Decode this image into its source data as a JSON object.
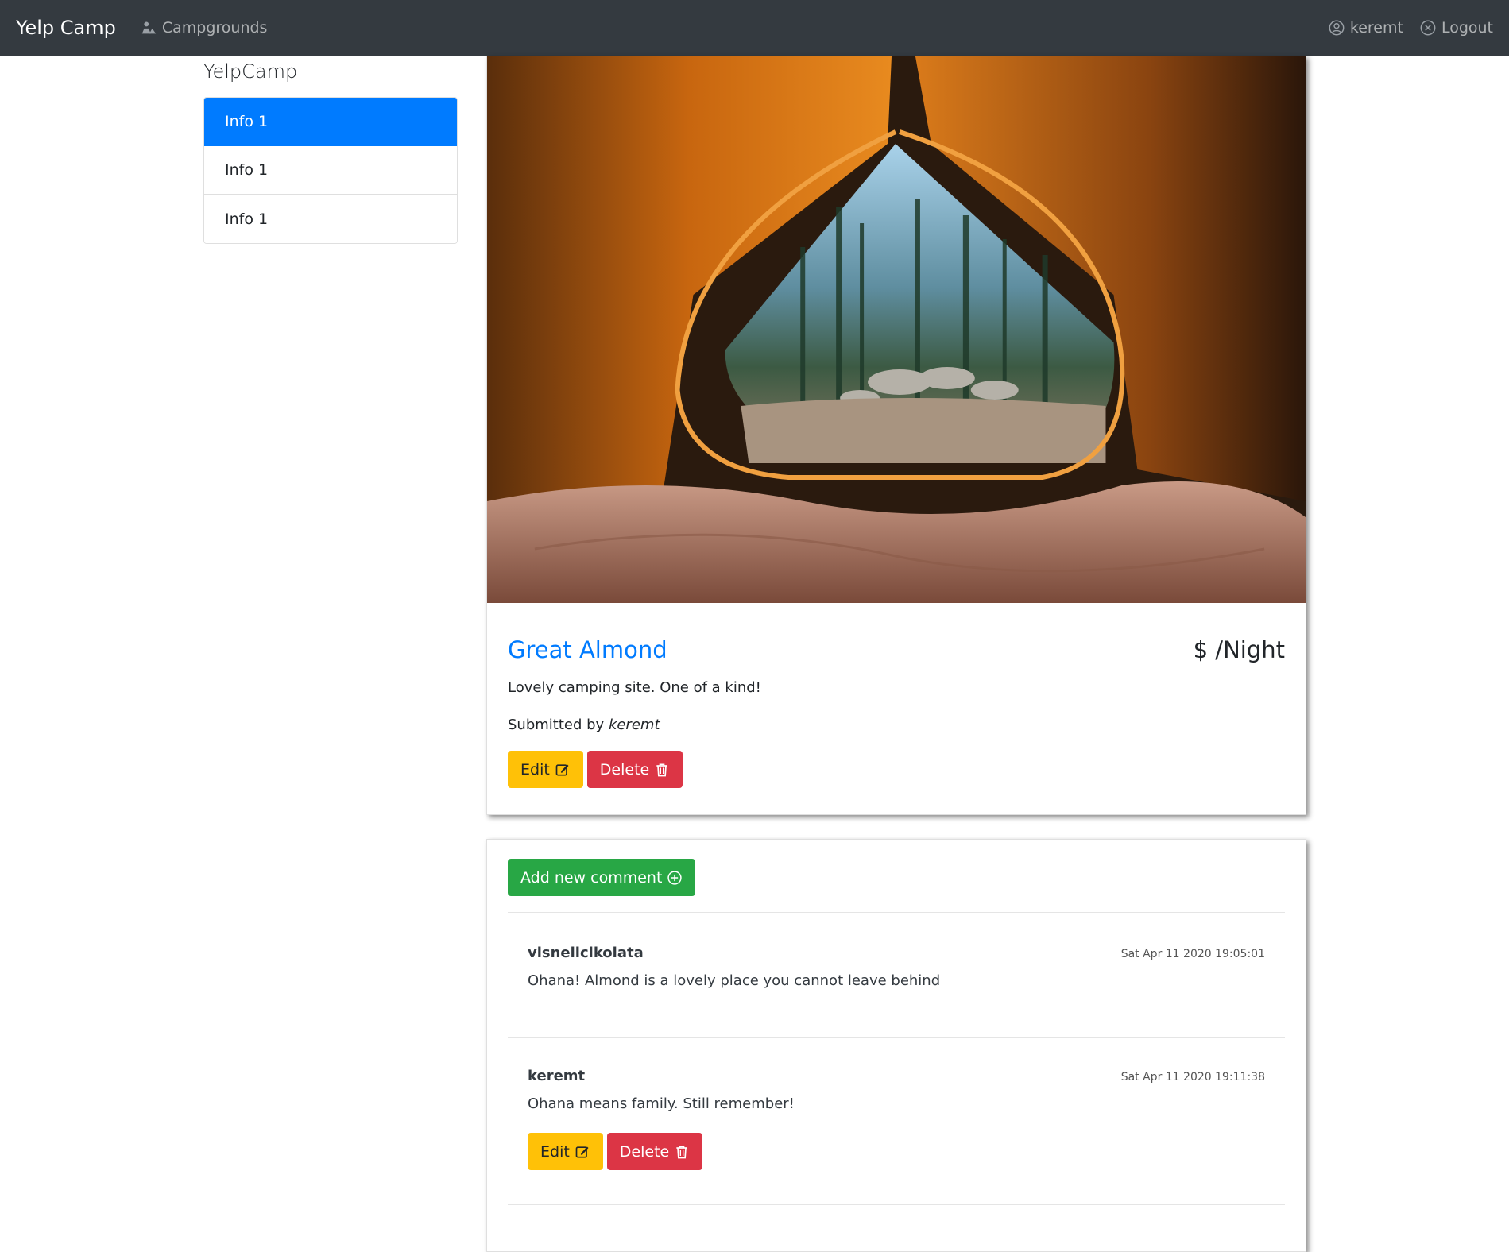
{
  "navbar": {
    "brand": "Yelp Camp",
    "campgrounds_label": "Campgrounds",
    "user_label": "keremt",
    "logout_label": "Logout"
  },
  "sidebar": {
    "lead": "YelpCamp",
    "items": [
      {
        "label": "Info 1",
        "active": true
      },
      {
        "label": "Info 1",
        "active": false
      },
      {
        "label": "Info 1",
        "active": false
      }
    ]
  },
  "campground": {
    "title": "Great Almond",
    "price": "$ /Night",
    "description": "Lovely camping site. One of a kind!",
    "submitted_prefix": "Submitted by ",
    "author": "keremt",
    "edit_label": "Edit",
    "delete_label": "Delete"
  },
  "comments": {
    "add_label": "Add new comment",
    "items": [
      {
        "author": "visnelicikolata",
        "date": "Sat Apr 11 2020 19:05:01",
        "text": "Ohana! Almond is a lovely place you cannot leave behind"
      },
      {
        "author": "keremt",
        "date": "Sat Apr 11 2020 19:11:38",
        "text": "Ohana means family. Still remember!",
        "edit_label": "Edit",
        "delete_label": "Delete"
      }
    ]
  },
  "colors": {
    "navbar_bg": "#343a40",
    "primary": "#007bff",
    "warning": "#ffc107",
    "danger": "#dc3545",
    "success": "#28a745"
  }
}
